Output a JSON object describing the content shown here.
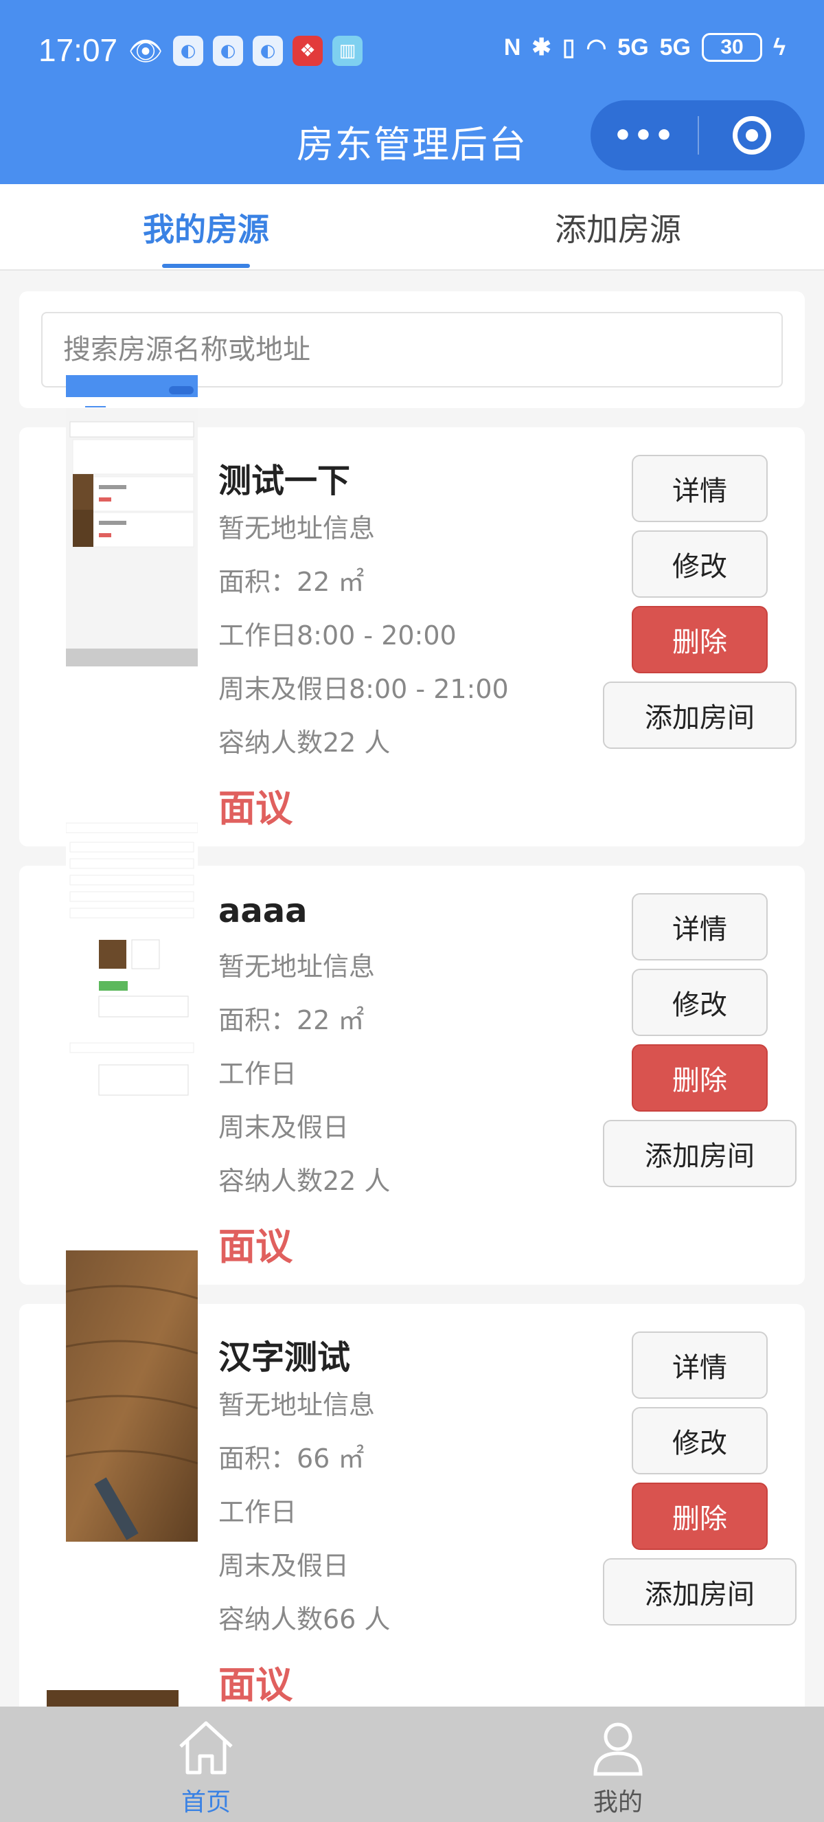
{
  "status_bar": {
    "time": "17:07",
    "network": "5G",
    "network2": "5G",
    "battery": "30"
  },
  "nav": {
    "title": "房东管理后台",
    "more_icon": "more-dots-icon",
    "close_icon": "target-icon"
  },
  "tabs": [
    {
      "label": "我的房源",
      "active": true
    },
    {
      "label": "添加房源",
      "active": false
    }
  ],
  "search": {
    "placeholder": "搜索房源名称或地址"
  },
  "listings": [
    {
      "name": "测试一下",
      "address": "暂无地址信息",
      "area": "面积：22 ㎡",
      "weekday": "工作日8:00 - 20:00",
      "weekend": "周末及假日8:00 - 21:00",
      "capacity": "容纳人数22 人",
      "price": "面议",
      "thumb": "screenshot"
    },
    {
      "name": "aaaa",
      "address": "暂无地址信息",
      "area": "面积：22 ㎡",
      "weekday": "工作日",
      "weekend": "周末及假日",
      "capacity": "容纳人数22 人",
      "price": "面议",
      "thumb": "form-screenshot"
    },
    {
      "name": "汉字测试",
      "address": "暂无地址信息",
      "area": "面积：66 ㎡",
      "weekday": "工作日",
      "weekend": "周末及假日",
      "capacity": "容纳人数66 人",
      "price": "面议",
      "thumb": "wood-floor-photo"
    }
  ],
  "buttons": {
    "detail": "详情",
    "edit": "修改",
    "delete": "删除",
    "add_room": "添加房间"
  },
  "tabbar": {
    "home": "首页",
    "me": "我的"
  },
  "colors": {
    "primary": "#4a8ff0",
    "accent_text": "#3a82e4",
    "danger": "#d9534f",
    "price": "#e0605e"
  }
}
